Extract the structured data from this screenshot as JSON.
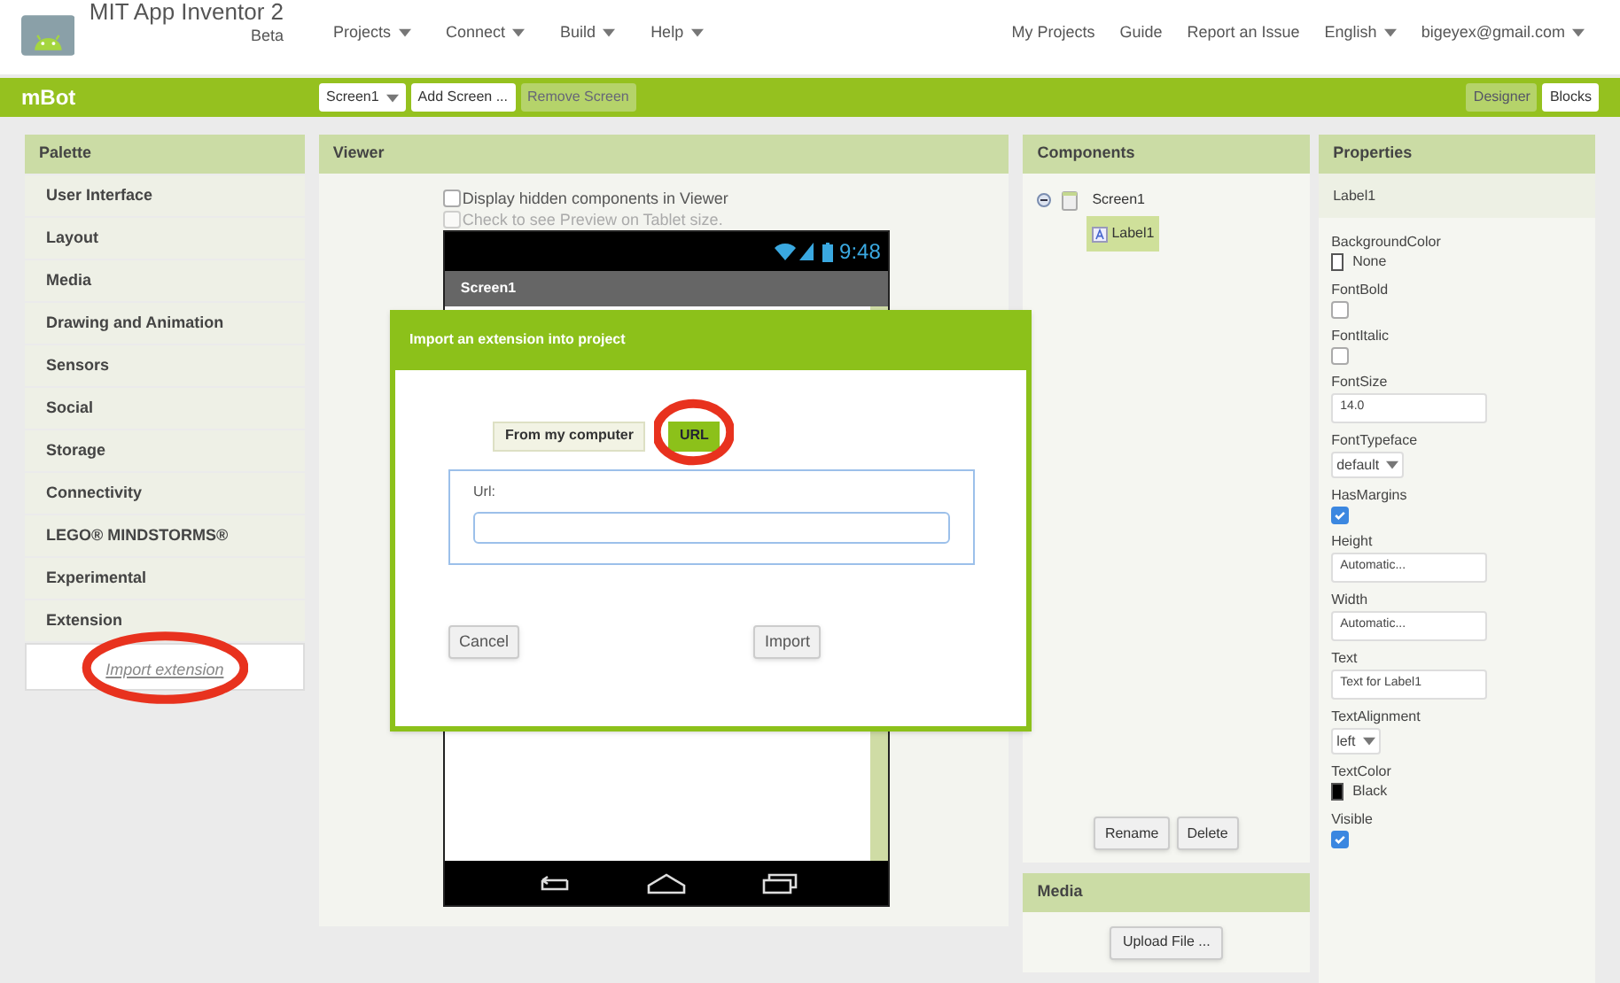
{
  "app": {
    "title": "MIT App Inventor 2",
    "subtitle": "Beta"
  },
  "nav_menus": [
    {
      "label": "Projects",
      "dropdown": true
    },
    {
      "label": "Connect",
      "dropdown": true
    },
    {
      "label": "Build",
      "dropdown": true
    },
    {
      "label": "Help",
      "dropdown": true
    }
  ],
  "nav_links": [
    {
      "label": "My Projects",
      "dropdown": false
    },
    {
      "label": "Guide",
      "dropdown": false
    },
    {
      "label": "Report an Issue",
      "dropdown": false
    },
    {
      "label": "English",
      "dropdown": true
    },
    {
      "label": "bigeyex@gmail.com",
      "dropdown": true
    }
  ],
  "project_bar": {
    "name": "mBot",
    "screen_select": "Screen1",
    "buttons": [
      {
        "label": "Add Screen ...",
        "disabled": false
      },
      {
        "label": "Remove Screen",
        "disabled": true
      }
    ],
    "views": [
      {
        "label": "Designer",
        "selected": true
      },
      {
        "label": "Blocks",
        "selected": false
      }
    ]
  },
  "palette": {
    "title": "Palette",
    "categories": [
      "User Interface",
      "Layout",
      "Media",
      "Drawing and Animation",
      "Sensors",
      "Social",
      "Storage",
      "Connectivity",
      "LEGO® MINDSTORMS®",
      "Experimental",
      "Extension"
    ],
    "extension_link": {
      "label": "Import extension",
      "highlighted": true
    }
  },
  "viewer": {
    "title": "Viewer",
    "options": [
      {
        "label": "Display hidden components in Viewer",
        "checked": false,
        "disabled": false
      },
      {
        "label": "Check to see Preview on Tablet size.",
        "checked": false,
        "disabled": true
      }
    ],
    "phone": {
      "time": "9:48",
      "screen_title": "Screen1"
    }
  },
  "components": {
    "title": "Components",
    "tree": [
      {
        "label": "Screen1",
        "expanded": true,
        "selected": false,
        "children": [
          {
            "label": "Label1",
            "selected": true
          }
        ]
      }
    ],
    "buttons": [
      "Rename",
      "Delete"
    ]
  },
  "media": {
    "title": "Media",
    "button": "Upload File ..."
  },
  "properties": {
    "title": "Properties",
    "component": "Label1",
    "items": [
      {
        "name": "BackgroundColor",
        "kind": "color",
        "value": "None",
        "color": "#ffffff"
      },
      {
        "name": "FontBold",
        "kind": "checkbox",
        "checked": false
      },
      {
        "name": "FontItalic",
        "kind": "checkbox",
        "checked": false
      },
      {
        "name": "FontSize",
        "kind": "text",
        "value": "14.0"
      },
      {
        "name": "FontTypeface",
        "kind": "dropdown",
        "value": "default"
      },
      {
        "name": "HasMargins",
        "kind": "checkbox",
        "checked": true
      },
      {
        "name": "Height",
        "kind": "text",
        "value": "Automatic..."
      },
      {
        "name": "Width",
        "kind": "text",
        "value": "Automatic..."
      },
      {
        "name": "Text",
        "kind": "text",
        "value": "Text for Label1"
      },
      {
        "name": "TextAlignment",
        "kind": "dropdown",
        "value": "left"
      },
      {
        "name": "TextColor",
        "kind": "color",
        "value": "Black",
        "color": "#000000"
      },
      {
        "name": "Visible",
        "kind": "checkbox",
        "checked": true
      }
    ]
  },
  "dialog": {
    "title": "Import an extension into project",
    "sources": [
      {
        "label": "From my computer",
        "selected": false,
        "highlighted": false
      },
      {
        "label": "URL",
        "selected": true,
        "highlighted": true
      }
    ],
    "url_label": "Url:",
    "buttons": [
      "Cancel",
      "Import"
    ]
  }
}
